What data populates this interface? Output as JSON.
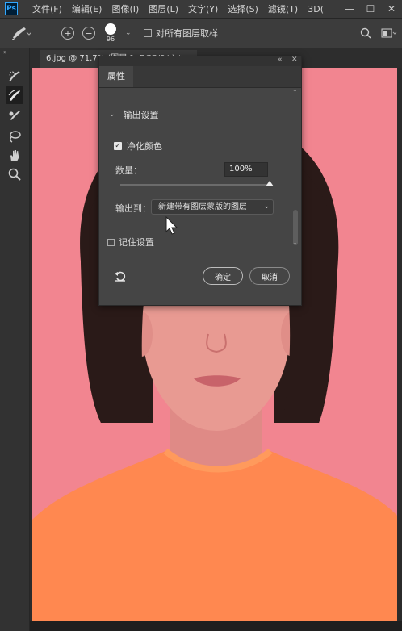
{
  "menubar": {
    "logo": "Ps",
    "items": [
      "文件(F)",
      "编辑(E)",
      "图像(I)",
      "图层(L)",
      "文字(Y)",
      "选择(S)",
      "滤镜(T)",
      "3D("
    ]
  },
  "options_bar": {
    "brush_size": "96",
    "sample_all_layers_label": "对所有图层取样"
  },
  "document": {
    "tab_title": "6.jpg @ 71.7% (图层 1, RGB/8#) * ×"
  },
  "properties_panel": {
    "tab_label": "属性",
    "section_title": "输出设置",
    "decontaminate_label": "净化颜色",
    "amount_label": "数量：",
    "amount_value": "100%",
    "amount_percent": 100,
    "output_to_label": "输出到：",
    "output_to_value": "新建带有图层蒙版的图层",
    "remember_label": "记住设置",
    "ok_label": "确定",
    "cancel_label": "取消"
  },
  "colors": {
    "canvas_bg": "#f28590",
    "shirt": "#ff8850",
    "hair": "#2a1a18",
    "skin": "#e89a92",
    "panel_bg": "#454545"
  }
}
